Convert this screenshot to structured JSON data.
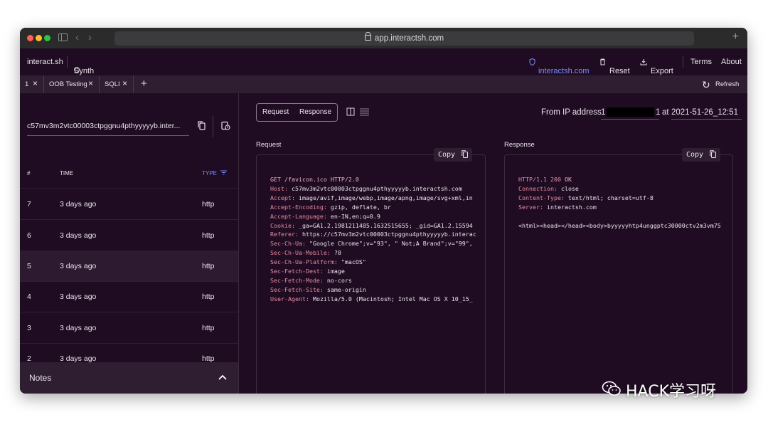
{
  "browser": {
    "url": "app.interactsh.com"
  },
  "header": {
    "brand": "interact.sh",
    "synth": "Synth",
    "server_link": "interactsh.com",
    "reset": "Reset",
    "export": "Export",
    "terms": "Terms",
    "about": "About"
  },
  "tabs": [
    {
      "label": "1"
    },
    {
      "label": "OOB Testing"
    },
    {
      "label": "SQLI"
    }
  ],
  "refresh_label": "Refresh",
  "left": {
    "host": "c57mv3m2vtc00003ctpggnu4pthyyyyyb.inter...",
    "columns": {
      "num": "#",
      "time": "TIME",
      "type": "TYPE"
    },
    "rows": [
      {
        "num": "7",
        "time": "3 days ago",
        "type": "http"
      },
      {
        "num": "6",
        "time": "3 days ago",
        "type": "http"
      },
      {
        "num": "5",
        "time": "3 days ago",
        "type": "http"
      },
      {
        "num": "4",
        "time": "3 days ago",
        "type": "http"
      },
      {
        "num": "3",
        "time": "3 days ago",
        "type": "http"
      },
      {
        "num": "2",
        "time": "3 days ago",
        "type": "http"
      }
    ],
    "notes": "Notes"
  },
  "detail": {
    "toggle_request": "Request",
    "toggle_response": "Response",
    "ip_prefix": "From IP address",
    "ip_start": "1",
    "ip_end": "1",
    "at_word": "at",
    "timestamp": "2021-51-26_12:51",
    "request_title": "Request",
    "response_title": "Response",
    "copy": "Copy",
    "request_first_line": "GET /favicon.ico HTTP/2.0",
    "request_headers": [
      {
        "k": "Host:",
        "v": " c57mv3m2vtc00003ctpggnu4pthyyyyyb.interactsh.com"
      },
      {
        "k": "Accept:",
        "v": " image/avif,image/webp,image/apng,image/svg+xml,in"
      },
      {
        "k": "Accept-Encoding:",
        "v": " gzip, deflate, br"
      },
      {
        "k": "Accept-Language:",
        "v": " en-IN,en;q=0.9"
      },
      {
        "k": "Cookie:",
        "v": " _ga=GA1.2.1981211485.1632515655; _gid=GA1.2.15594"
      },
      {
        "k": "Referer:",
        "v": " https://c57mv3m2vtc00003ctpggnu4pthyyyyyb.interac"
      },
      {
        "k": "Sec-Ch-Ua:",
        "v": " \"Google Chrome\";v=\"93\", \" Not;A Brand\";v=\"99\","
      },
      {
        "k": "Sec-Ch-Ua-Mobile:",
        "v": " ?0"
      },
      {
        "k": "Sec-Ch-Ua-Platform:",
        "v": " \"macOS\""
      },
      {
        "k": "Sec-Fetch-Dest:",
        "v": " image"
      },
      {
        "k": "Sec-Fetch-Mode:",
        "v": " no-cors"
      },
      {
        "k": "Sec-Fetch-Site:",
        "v": " same-origin"
      },
      {
        "k": "User-Agent:",
        "v": " Mozilla/5.0 (Macintosh; Intel Mac OS X 10_15_"
      }
    ],
    "response_status": "HTTP/1.1 200",
    "response_ok": " OK",
    "response_headers": [
      {
        "k": "Connection:",
        "v": " close"
      },
      {
        "k": "Content-Type:",
        "v": " text/html; charset=utf-8"
      },
      {
        "k": "Server:",
        "v": " interactsh.com"
      }
    ],
    "response_body": "<html><head></head><body>byyyyyhtp4unggptc30000ctv2m3vm75"
  },
  "watermark": "HACK学习呀"
}
